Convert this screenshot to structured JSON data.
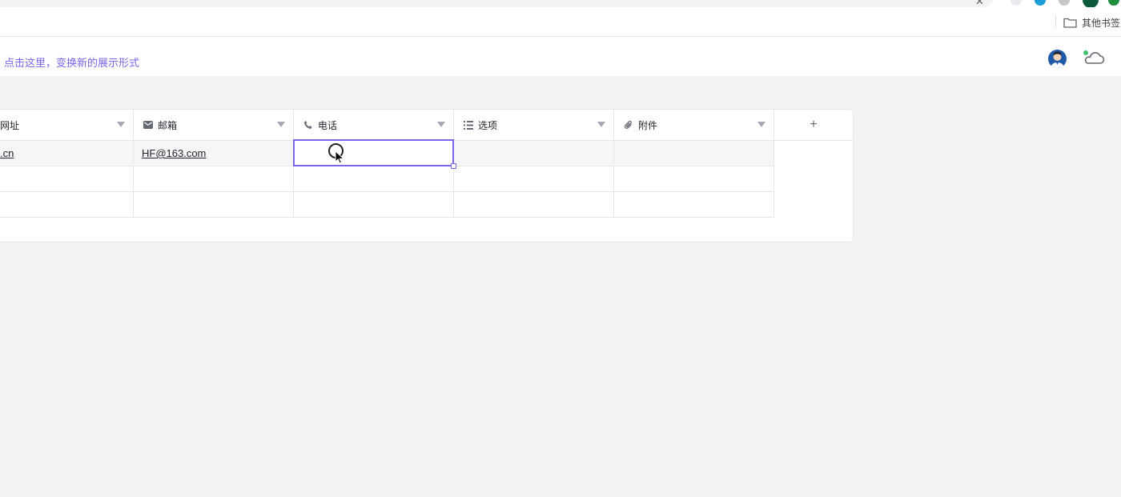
{
  "browser": {
    "bookmarks_folder_label": "其他书签"
  },
  "app": {
    "view_hint": "点击这里，变换新的展示形式"
  },
  "table": {
    "columns": [
      {
        "label": "网址",
        "icon": "link-icon"
      },
      {
        "label": "邮箱",
        "icon": "mail-icon"
      },
      {
        "label": "电话",
        "icon": "phone-icon"
      },
      {
        "label": "选项",
        "icon": "options-list-icon"
      },
      {
        "label": "附件",
        "icon": "paperclip-icon"
      }
    ],
    "add_column_label": "+",
    "rows": [
      {
        "url": ".cn",
        "email": "HF@163.com",
        "phone": "",
        "options": "",
        "attachment": ""
      },
      {
        "url": "",
        "email": "",
        "phone": "",
        "options": "",
        "attachment": ""
      },
      {
        "url": "",
        "email": "",
        "phone": "",
        "options": "",
        "attachment": ""
      }
    ]
  },
  "colors": {
    "accent": "#7b67ee",
    "cloud_status": "#3ec46d"
  }
}
